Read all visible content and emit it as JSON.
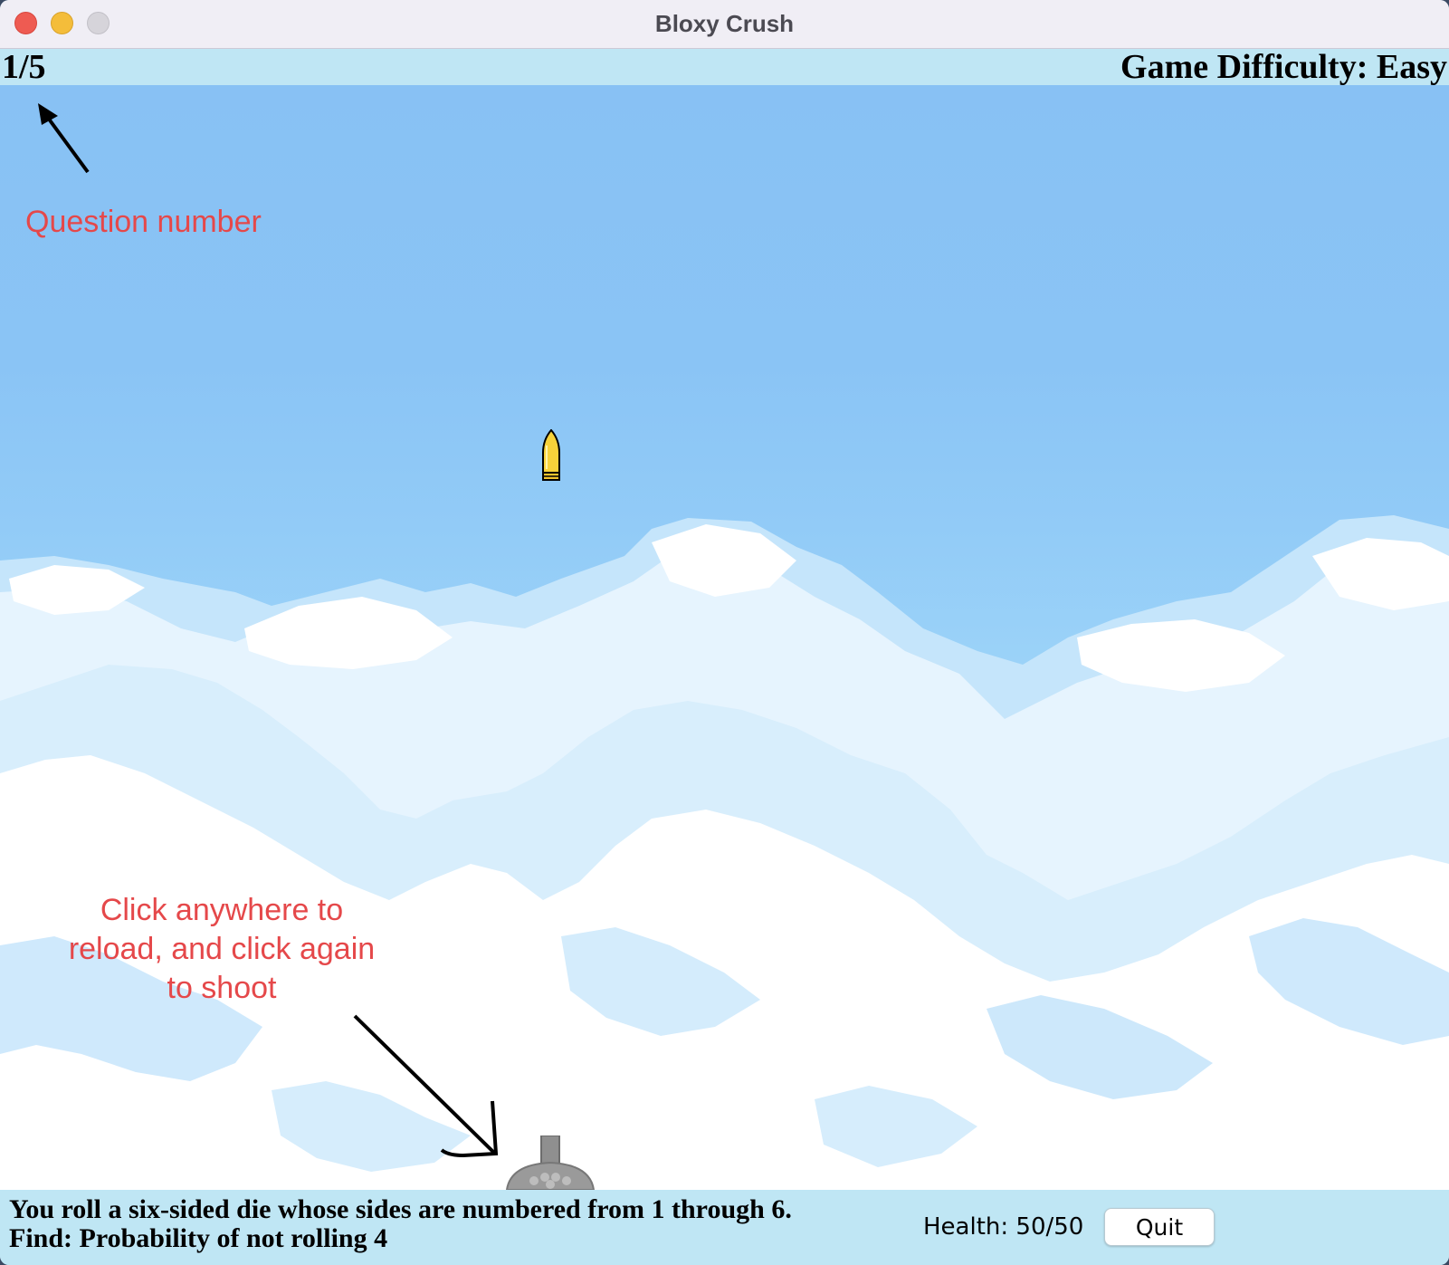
{
  "window": {
    "title": "Bloxy Crush"
  },
  "hud": {
    "question_number": "1/5",
    "difficulty": "Game Difficulty: Easy"
  },
  "annotations": {
    "question_label": "Question number",
    "reload_hint": "Click anywhere to reload, and click again to shoot"
  },
  "problem": {
    "line1": "You roll a six-sided die whose sides are numbered from 1 through 6.",
    "line2": "Find: Probability of not rolling 4"
  },
  "status": {
    "health": "Health: 50/50",
    "quit_label": "Quit"
  },
  "colors": {
    "annotation": "#e5484a",
    "sky_top": "#88c1f4",
    "bar": "#bfe6f4",
    "bullet": "#f7d23a"
  },
  "icons": [
    "close-icon",
    "minimize-icon",
    "maximize-icon",
    "bullet-icon",
    "cannon-icon",
    "arrow-icon"
  ]
}
